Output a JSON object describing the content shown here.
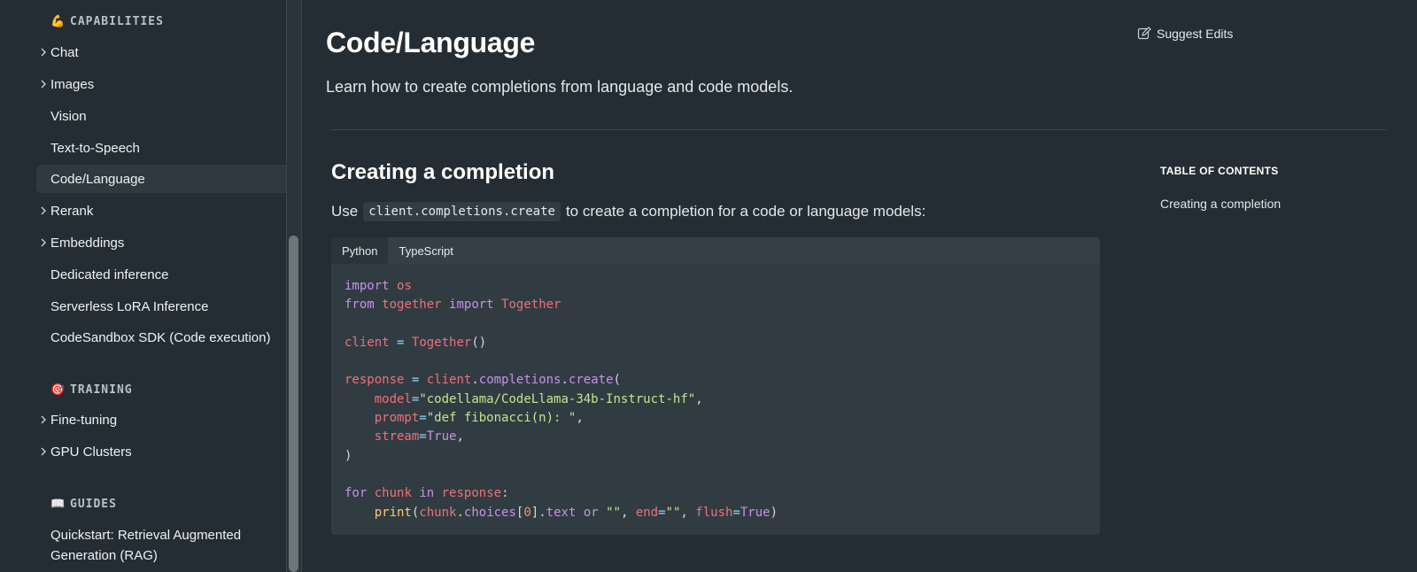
{
  "sidebar": {
    "sections": [
      {
        "emoji": "💪",
        "title": "CAPABILITIES"
      },
      {
        "emoji": "🎯",
        "title": "TRAINING"
      },
      {
        "emoji": "📖",
        "title": "GUIDES"
      }
    ],
    "capabilities_items": [
      {
        "label": "Chat",
        "expandable": true
      },
      {
        "label": "Images",
        "expandable": true
      },
      {
        "label": "Vision",
        "expandable": false
      },
      {
        "label": "Text-to-Speech",
        "expandable": false
      },
      {
        "label": "Code/Language",
        "expandable": false,
        "active": true
      },
      {
        "label": "Rerank",
        "expandable": true
      },
      {
        "label": "Embeddings",
        "expandable": true
      },
      {
        "label": "Dedicated inference",
        "expandable": false
      },
      {
        "label": "Serverless LoRA Inference",
        "expandable": false
      },
      {
        "label": "CodeSandbox SDK (Code execution)",
        "expandable": false
      }
    ],
    "training_items": [
      {
        "label": "Fine-tuning",
        "expandable": true
      },
      {
        "label": "GPU Clusters",
        "expandable": true
      }
    ],
    "guides_items": [
      {
        "label_line1": "Quickstart: Retrieval Augmented",
        "label_line2": "Generation (RAG)"
      }
    ]
  },
  "main": {
    "title": "Code/Language",
    "description": "Learn how to create completions from language and code models.",
    "suggest_edits": "Suggest Edits",
    "section_heading": "Creating a completion",
    "para_before": "Use",
    "inline_code": "client.completions.create",
    "para_after": "to create a completion for a code or language models:",
    "code_tabs": [
      "Python",
      "TypeScript"
    ],
    "active_tab": "Python"
  },
  "toc": {
    "title": "TABLE OF CONTENTS",
    "items": [
      "Creating a completion"
    ]
  }
}
